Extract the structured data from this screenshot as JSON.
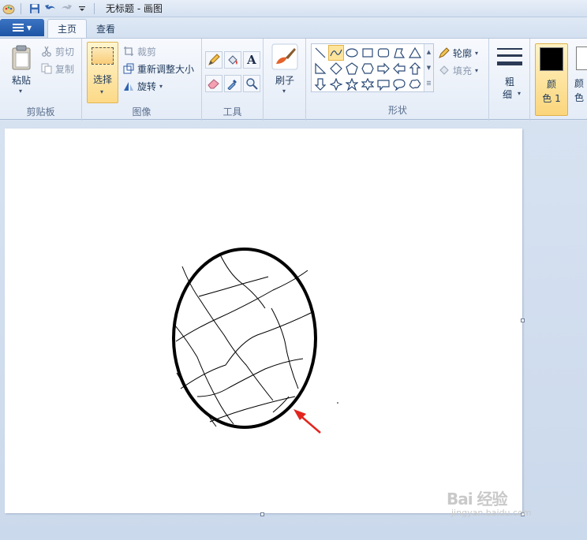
{
  "titlebar": {
    "title": "无标题 - 画图"
  },
  "tabs": [
    {
      "label": "主页",
      "active": true
    },
    {
      "label": "查看",
      "active": false
    }
  ],
  "clipboard": {
    "paste_label": "粘贴",
    "cut_label": "剪切",
    "copy_label": "复制",
    "group_label": "剪贴板"
  },
  "image": {
    "select_label": "选择",
    "crop_label": "裁剪",
    "resize_label": "重新调整大小",
    "rotate_label": "旋转",
    "group_label": "图像"
  },
  "tools": {
    "group_label": "工具",
    "items": [
      "pencil-icon",
      "fill-bucket-icon",
      "text-icon",
      "eraser-icon",
      "color-picker-icon",
      "magnifier-icon"
    ]
  },
  "brushes": {
    "label": "刷子"
  },
  "shapes": {
    "outline_label": "轮廓",
    "fill_label": "填充",
    "group_label": "形状",
    "selected": "curve"
  },
  "size": {
    "label_line1": "粗",
    "label_line2": "细"
  },
  "colors": {
    "color1_line1": "颜",
    "color1_line2": "色 1",
    "color2_line1": "颜",
    "color2_line2": "色",
    "color1_value": "#000000",
    "color2_value": "#ffffff"
  },
  "watermark": {
    "logo": "Bai 经验",
    "url": "jingyan.baidu.com"
  }
}
